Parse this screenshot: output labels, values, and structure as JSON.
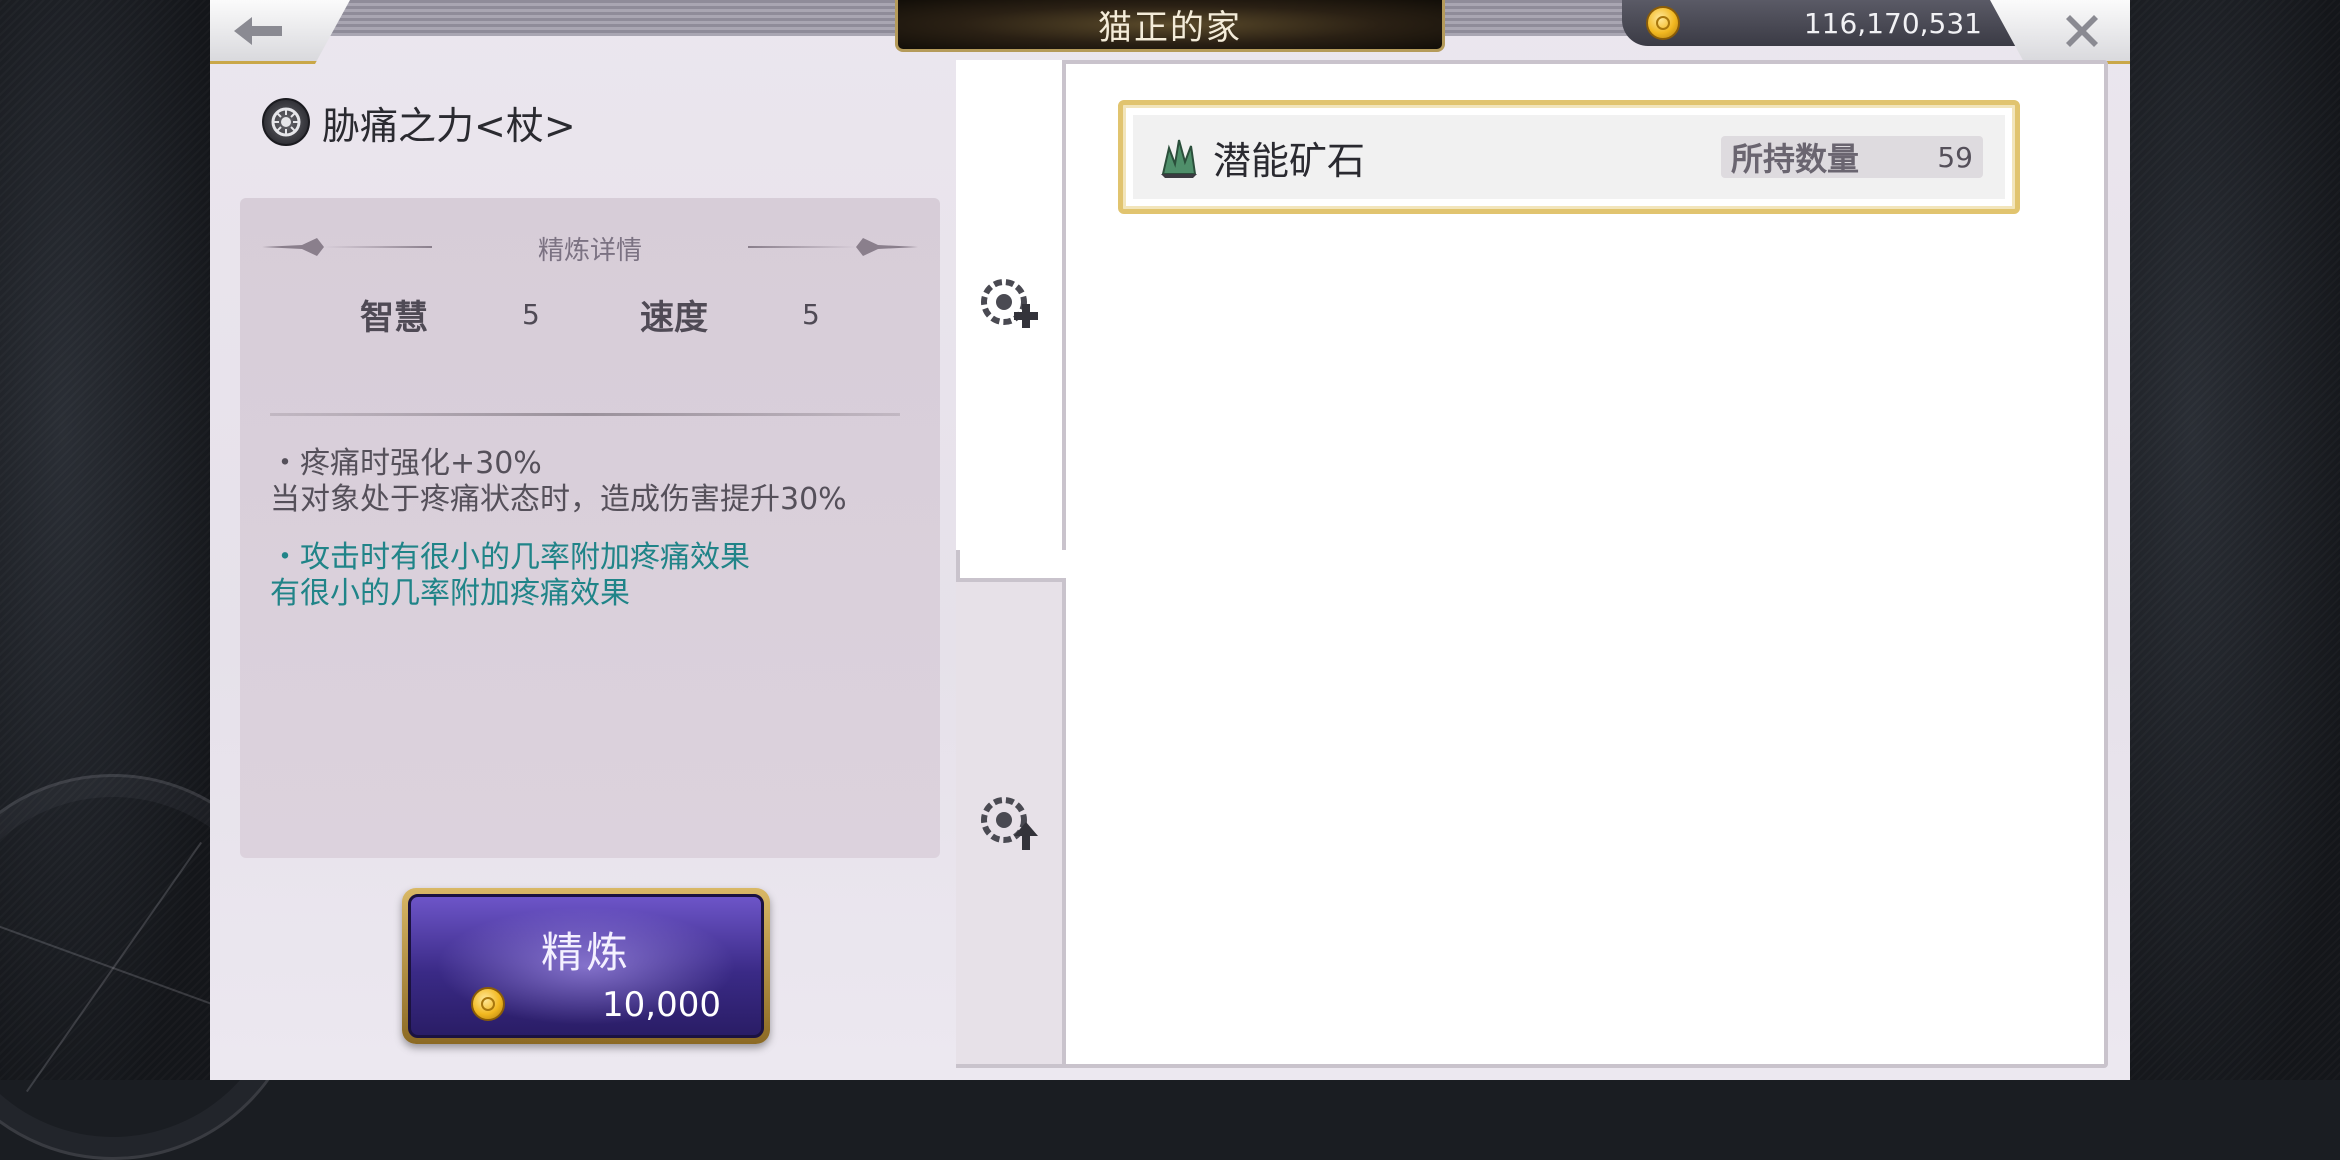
{
  "header": {
    "title": "猫正的家",
    "gold_amount": "116,170,531"
  },
  "item": {
    "name": "胁痛之力<杖>"
  },
  "detail": {
    "header": "精炼详情",
    "stats": [
      {
        "label": "智慧",
        "value": "5"
      },
      {
        "label": "速度",
        "value": "5"
      }
    ],
    "effects": [
      {
        "title": "・疼痛时强化+30%",
        "desc": "当对象处于疼痛状态时，造成伤害提升30%"
      },
      {
        "title": "・攻击时有很小的几率附加疼痛效果",
        "desc": "有很小的几率附加疼痛效果"
      }
    ]
  },
  "refine_button": {
    "label": "精炼",
    "cost": "10,000"
  },
  "materials": {
    "items": [
      {
        "name": "潜能矿石",
        "owned_label": "所持数量",
        "owned_count": "59"
      }
    ]
  },
  "colors": {
    "gold_accent": "#e1c46f",
    "teal_text": "#208488",
    "refine_purple": "#4a36a8"
  },
  "icons": {
    "back": "arrow-left-icon",
    "close": "close-icon",
    "currency": "gold-coin-icon",
    "item": "gear-emblem-icon",
    "tab_add": "gear-plus-icon",
    "tab_upgrade": "gear-up-arrow-icon",
    "material": "crystal-ore-icon"
  }
}
